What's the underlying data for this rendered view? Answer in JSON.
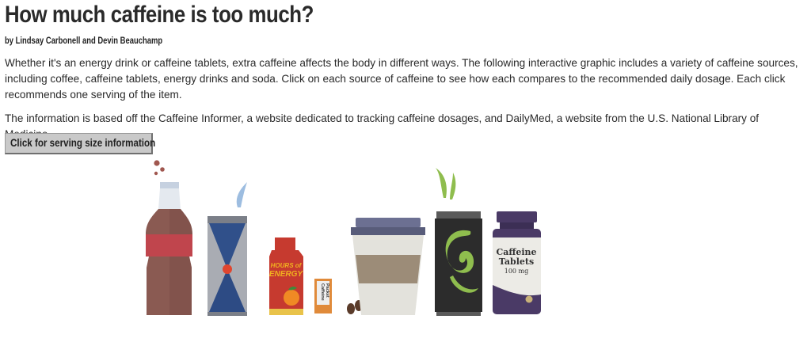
{
  "article": {
    "title": "How much caffeine is too much?",
    "byline": "by Lindsay Carbonell and Devin Beauchamp",
    "paragraph1": "Whether it's an energy drink or caffeine tablets, extra caffeine affects the body in different ways. The following interactive graphic includes a variety of caffeine sources, including coffee, caffeine tablets, energy drinks and soda. Click on each source of caffeine to see how each compares to the recommended daily dosage. Each click recommends one serving of the item.",
    "paragraph2": "The information is based off the Caffeine Informer, a website dedicated to tracking caffeine dosages, and DailyMed, a website from the U.S. National Library of Medicine."
  },
  "button": {
    "label": "Click for serving size information"
  },
  "graphic": {
    "energy_shot_label": {
      "line1": "HOURS of",
      "line2": "ENERGY"
    },
    "packet_label": {
      "line1": "Caffeine",
      "line2": "Packet"
    },
    "tablets_label": {
      "line1": "Caffeine",
      "line2": "Tablets",
      "line3": "100 mg"
    }
  },
  "colors": {
    "soda": "#8a5a52",
    "soda_label": "#c0454d",
    "can_blue": "#30508a",
    "can_silver": "#a9acb3",
    "coffee_cup": "#e3e2dc",
    "coffee_sleeve": "#9c8c78",
    "coffee_lid": "#6c7092",
    "monster_can": "#2c2c2c",
    "monster_green": "#8fbd4e",
    "bottle_purple": "#4a3a66"
  }
}
